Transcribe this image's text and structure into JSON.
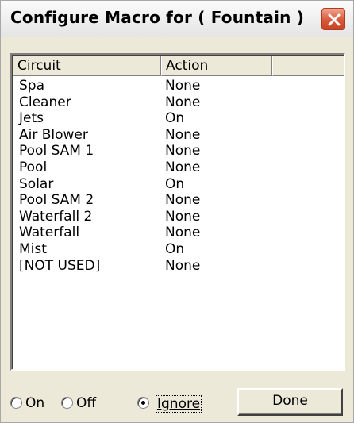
{
  "window": {
    "title": "Configure Macro for ( Fountain )"
  },
  "list": {
    "columns": [
      "Circuit",
      "Action",
      ""
    ],
    "rows": [
      {
        "circuit": "Spa",
        "action": "None"
      },
      {
        "circuit": "Cleaner",
        "action": "None"
      },
      {
        "circuit": "Jets",
        "action": "On"
      },
      {
        "circuit": "Air Blower",
        "action": "None"
      },
      {
        "circuit": "Pool SAM 1",
        "action": "None"
      },
      {
        "circuit": "Pool",
        "action": "None"
      },
      {
        "circuit": "Solar",
        "action": "On"
      },
      {
        "circuit": "Pool SAM 2",
        "action": "None"
      },
      {
        "circuit": "Waterfall 2",
        "action": "None"
      },
      {
        "circuit": "Waterfall",
        "action": "None"
      },
      {
        "circuit": "Mist",
        "action": "On"
      },
      {
        "circuit": "[NOT USED]",
        "action": "None"
      }
    ]
  },
  "options": {
    "on_label": "On",
    "off_label": "Off",
    "ignore_label": "Ignore",
    "selected": "Ignore"
  },
  "buttons": {
    "done_label": "Done"
  },
  "colors": {
    "close_button": "#d8583a",
    "dialog_bg": "#ece9d8"
  },
  "icons": {
    "close": "close-icon"
  }
}
